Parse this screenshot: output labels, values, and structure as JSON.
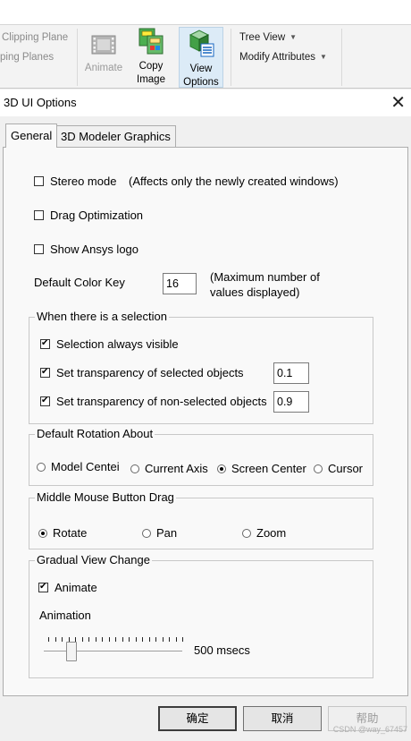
{
  "ribbon": {
    "clipping_plane": "Clipping Plane",
    "clipping_planes": "ping Planes",
    "animate_label": "Animate",
    "copy_image_line1": "Copy",
    "copy_image_line2": "Image",
    "view_options_line1": "View",
    "view_options_line2": "Options",
    "tree_view": "Tree View",
    "modify_attributes": "Modify Attributes"
  },
  "dialog": {
    "title": "3D UI Options",
    "close_glyph": "✕",
    "tabs": [
      "General",
      "3D Modeler Graphics"
    ]
  },
  "general": {
    "stereo_mode": "Stereo mode",
    "stereo_note": "(Affects only the newly created windows)",
    "drag_optimization": "Drag Optimization",
    "show_logo": "Show Ansys logo",
    "default_color_key": "Default Color Key",
    "color_key_value": "16",
    "color_key_note_line1": "(Maximum number of",
    "color_key_note_line2": "values displayed)"
  },
  "selection_group": {
    "legend": "When there is a selection",
    "always_visible": "Selection always visible",
    "transparency_selected": "Set transparency of selected objects",
    "transparency_selected_value": "0.1",
    "transparency_nonselected": "Set transparency of non-selected objects",
    "transparency_nonselected_value": "0.9"
  },
  "rotation_group": {
    "legend": "Default Rotation About",
    "options": [
      "Model Centei",
      "Current Axis",
      "Screen Center",
      "Cursor"
    ],
    "selected": "Screen Center"
  },
  "middle_mouse_group": {
    "legend": "Middle Mouse Button Drag",
    "options": [
      "Rotate",
      "Pan",
      "Zoom"
    ],
    "selected": "Rotate"
  },
  "gradual_view_group": {
    "legend": "Gradual View Change",
    "animate": "Animate",
    "animation_label": "Animation",
    "animation_value_text": "500 msecs",
    "slider_fraction": 0.2
  },
  "buttons": {
    "ok": "确定",
    "cancel": "取消",
    "help": "帮助"
  },
  "watermark": "CSDN @way_67457"
}
